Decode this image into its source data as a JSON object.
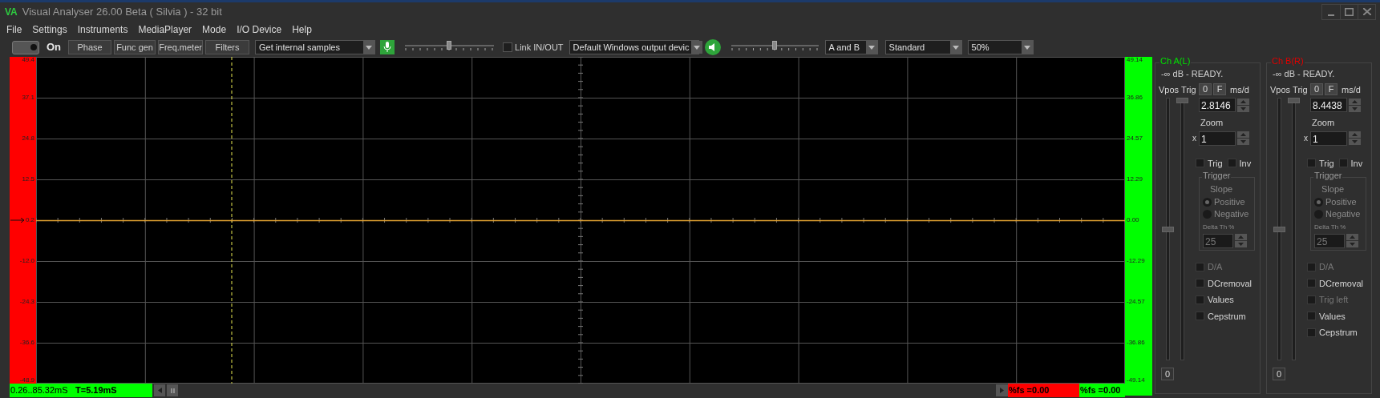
{
  "window": {
    "logo": "VA",
    "title": "Visual Analyser 26.00 Beta ( Silvia ) - 32 bit"
  },
  "menu": [
    "File",
    "Settings",
    "Instruments",
    "MediaPlayer",
    "Mode",
    "I/O Device",
    "Help"
  ],
  "toolbar": {
    "power": {
      "on": true,
      "label": "On"
    },
    "buttons": [
      "Phase",
      "Func gen",
      "Freq.meter",
      "Filters"
    ],
    "source": "Get internal samples",
    "input_slider": {
      "level": 0.5
    },
    "link": {
      "label": "Link IN/OUT",
      "checked": false
    },
    "output": "Default Windows output devic",
    "output_slider": {
      "level": 0.5
    },
    "channels": "A and B",
    "mode": "Standard",
    "percent": "50%"
  },
  "scope": {
    "left_labels": [
      "49.4",
      "37.1",
      "24.8",
      "12.5",
      "0.2",
      "-12.0",
      "-24.3",
      "-36.6",
      "-48.9"
    ],
    "right_labels": [
      "49.14",
      "36.86",
      "24.57",
      "12.29",
      "0.00",
      "-12.29",
      "-24.57",
      "-36.86",
      "-49.14"
    ]
  },
  "status": {
    "range": "0.26..85.32mS",
    "period": "T=5.19mS",
    "fs_a": "%fs =0.00",
    "fs_b": "%fs =0.00"
  },
  "channels": [
    {
      "title": "Ch A(L)",
      "color": "#00e000",
      "status": "-∞ dB - READY.",
      "vpos_label": "Vpos",
      "trig_label": "Trig",
      "zero": "0",
      "f": "F",
      "unit": "ms/d",
      "timebase": "2.8146",
      "zoom_label": "Zoom",
      "zoom_prefix": "x",
      "zoom": "1",
      "vpos_slider": {
        "level": 0.5
      },
      "trig_slider": {
        "level": 1
      },
      "checks": [
        {
          "label": "Trig",
          "checked": false
        },
        {
          "label": "Inv",
          "checked": false
        }
      ],
      "trigger": {
        "title": "Trigger",
        "slope": "Slope",
        "disabled": true,
        "radios": [
          {
            "label": "Positive",
            "selected": true
          },
          {
            "label": "Negative",
            "selected": false
          }
        ],
        "delta_label": "Delta Th %",
        "delta": "25"
      },
      "options": [
        {
          "label": "D/A",
          "checked": false,
          "disabled": true
        },
        {
          "label": "DCremoval",
          "checked": false,
          "disabled": false
        },
        {
          "label": "Values",
          "checked": false,
          "disabled": false
        },
        {
          "label": "Cepstrum",
          "checked": false,
          "disabled": false
        }
      ],
      "reset": "0"
    },
    {
      "title": "Ch B(R)",
      "color": "#e00000",
      "status": "-∞ dB - READY.",
      "vpos_label": "Vpos",
      "trig_label": "Trig",
      "zero": "0",
      "f": "F",
      "unit": "ms/d",
      "timebase": "8.4438",
      "zoom_label": "Zoom",
      "zoom_prefix": "x",
      "zoom": "1",
      "vpos_slider": {
        "level": 0.5
      },
      "trig_slider": {
        "level": 1
      },
      "checks": [
        {
          "label": "Trig",
          "checked": false
        },
        {
          "label": "Inv",
          "checked": false
        }
      ],
      "trigger": {
        "title": "Trigger",
        "slope": "Slope",
        "disabled": true,
        "radios": [
          {
            "label": "Positive",
            "selected": true
          },
          {
            "label": "Negative",
            "selected": false
          }
        ],
        "delta_label": "Delta Th %",
        "delta": "25"
      },
      "options": [
        {
          "label": "D/A",
          "checked": false,
          "disabled": true
        },
        {
          "label": "DCremoval",
          "checked": false,
          "disabled": false
        },
        {
          "label": "Trig left",
          "checked": false,
          "disabled": true
        },
        {
          "label": "Values",
          "checked": false,
          "disabled": false
        },
        {
          "label": "Cepstrum",
          "checked": false,
          "disabled": false
        }
      ],
      "reset": "0"
    }
  ]
}
